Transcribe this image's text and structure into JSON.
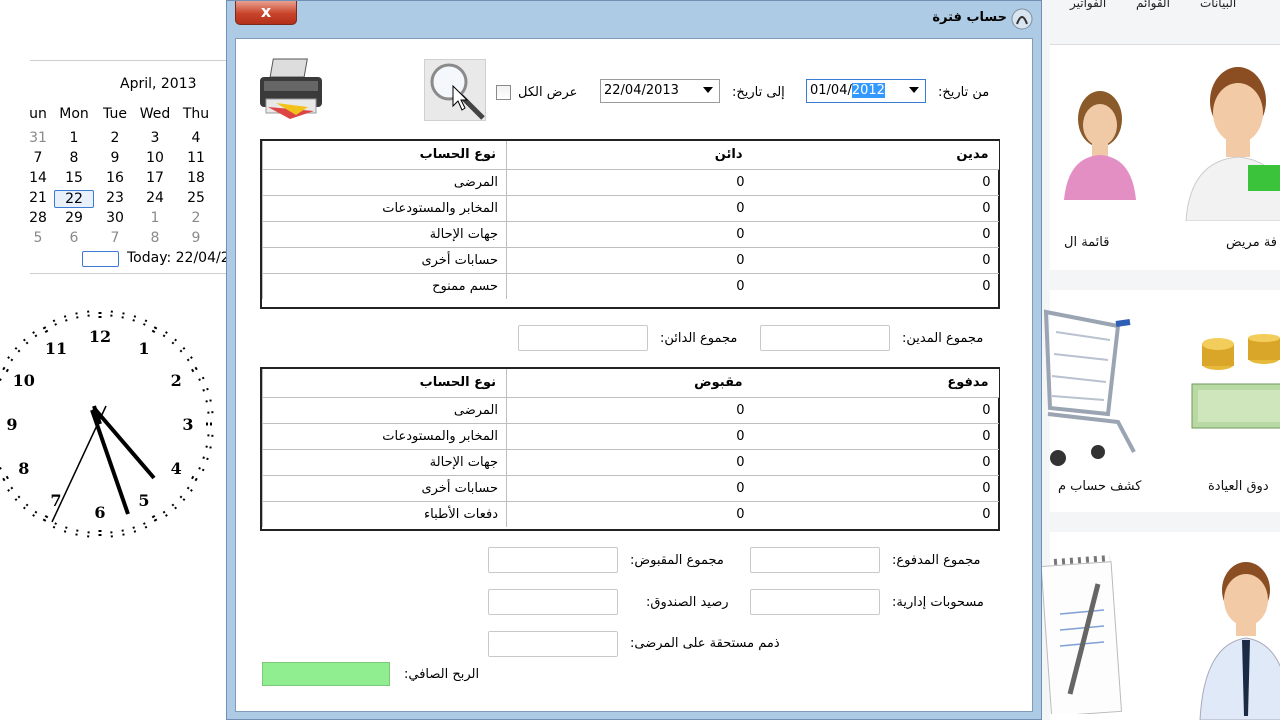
{
  "calendar": {
    "title": "April, 2013",
    "weekdays": [
      "un",
      "Mon",
      "Tue",
      "Wed",
      "Thu"
    ],
    "rows": [
      [
        "31",
        "1",
        "2",
        "3",
        "4"
      ],
      [
        "7",
        "8",
        "9",
        "10",
        "11"
      ],
      [
        "14",
        "15",
        "16",
        "17",
        "18"
      ],
      [
        "21",
        "22",
        "23",
        "24",
        "25"
      ],
      [
        "28",
        "29",
        "30",
        "1",
        "2"
      ],
      [
        "5",
        "6",
        "7",
        "8",
        "9"
      ]
    ],
    "today_label": "Today: 22/04/2",
    "selected": "22"
  },
  "clock": {
    "numerals": [
      "12",
      "1",
      "2",
      "3",
      "4",
      "5",
      "6",
      "7",
      "8",
      "9",
      "10",
      "11"
    ]
  },
  "background_app": {
    "menu": [
      "البيانات",
      "القوائم",
      "الفواتير"
    ],
    "labels": [
      "قائمة ال",
      "فة مريض",
      "كشف حساب م",
      "دوق العيادة"
    ]
  },
  "dialog": {
    "title": "حساب فترة",
    "close_label": "x",
    "from_date_label": "من تاريخ:",
    "from_date_value_prefix": "01/04/",
    "from_date_value_selected": "2012",
    "to_date_label": "إلى تاريخ:",
    "to_date_value": "22/04/2013",
    "show_all_label": "عرض الكل",
    "accounts_grid": {
      "headers": [
        "مدين",
        "دائن",
        "نوع الحساب"
      ],
      "rows": [
        [
          "0",
          "0",
          "المرضى"
        ],
        [
          "0",
          "0",
          "المخابر والمستودعات"
        ],
        [
          "0",
          "0",
          "جهات الإحالة"
        ],
        [
          "0",
          "0",
          "حسابات أخرى"
        ],
        [
          "0",
          "0",
          "حسم ممنوح"
        ]
      ]
    },
    "debit_total_label": "مجموع المدين:",
    "credit_total_label": "مجموع الدائن:",
    "payments_grid": {
      "headers": [
        "مدفوع",
        "مقبوض",
        "نوع الحساب"
      ],
      "rows": [
        [
          "0",
          "0",
          "المرضى"
        ],
        [
          "0",
          "0",
          "المخابر والمستودعات"
        ],
        [
          "0",
          "0",
          "جهات الإحالة"
        ],
        [
          "0",
          "0",
          "حسابات أخرى"
        ],
        [
          "0",
          "0",
          "دفعات الأطباء"
        ]
      ]
    },
    "paid_total_label": "مجموع المدفوع:",
    "received_total_label": "مجموع المقبوض:",
    "admin_withdrawals_label": "مسحوبات إدارية:",
    "box_balance_label": "رصيد الصندوق:",
    "patient_dues_label": "ذمم مستحقة على المرضى:",
    "net_profit_label": "الربح الصافي:",
    "colors": {
      "profit_fill": "#90ee90",
      "titlebar": "#aecbe6",
      "close": "#c9432a"
    }
  }
}
